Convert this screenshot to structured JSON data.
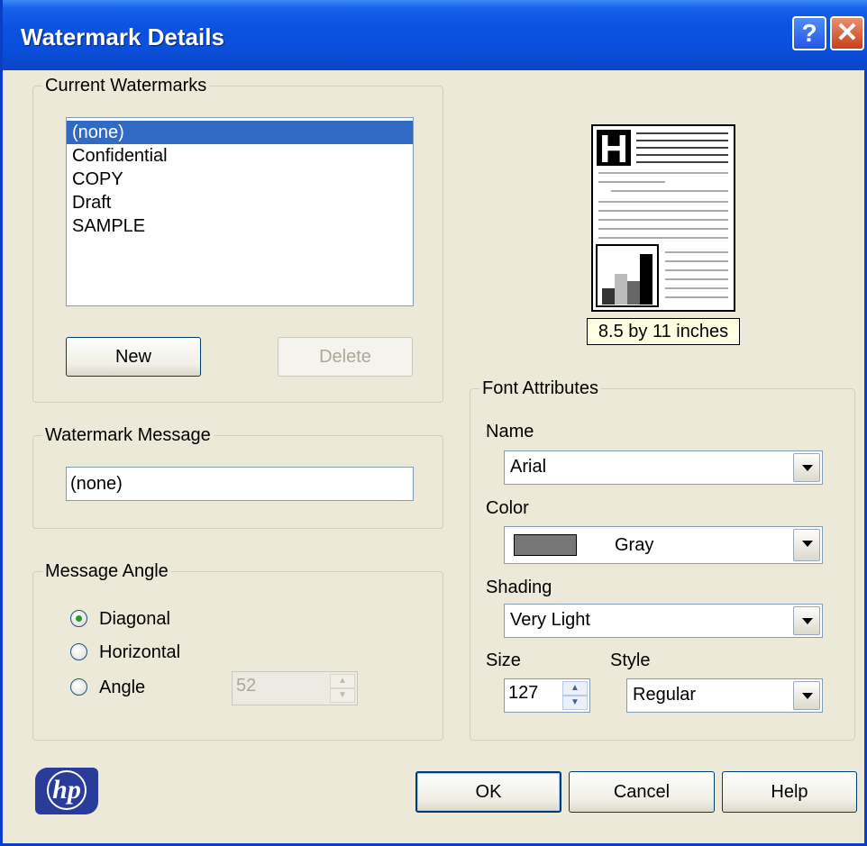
{
  "window": {
    "title": "Watermark Details",
    "help_glyph": "?",
    "close_glyph": "✕"
  },
  "current_watermarks": {
    "label": "Current Watermarks",
    "items": [
      "(none)",
      "Confidential",
      "COPY",
      "Draft",
      "SAMPLE"
    ],
    "selected_index": 0,
    "new_label": "New",
    "delete_label": "Delete"
  },
  "watermark_message": {
    "label": "Watermark Message",
    "value": "(none)"
  },
  "message_angle": {
    "label": "Message Angle",
    "options": [
      "Diagonal",
      "Horizontal",
      "Angle"
    ],
    "selected": "Diagonal",
    "angle_value": "52"
  },
  "preview": {
    "letter": "H",
    "caption": "8.5 by 11 inches"
  },
  "font_attributes": {
    "label": "Font Attributes",
    "name_label": "Name",
    "name_value": "Arial",
    "color_label": "Color",
    "color_value": "Gray",
    "color_swatch": "#777777",
    "shading_label": "Shading",
    "shading_value": "Very Light",
    "size_label": "Size",
    "size_value": "127",
    "style_label": "Style",
    "style_value": "Regular"
  },
  "footer": {
    "logo_text": "hp",
    "ok_label": "OK",
    "cancel_label": "Cancel",
    "help_label": "Help"
  }
}
